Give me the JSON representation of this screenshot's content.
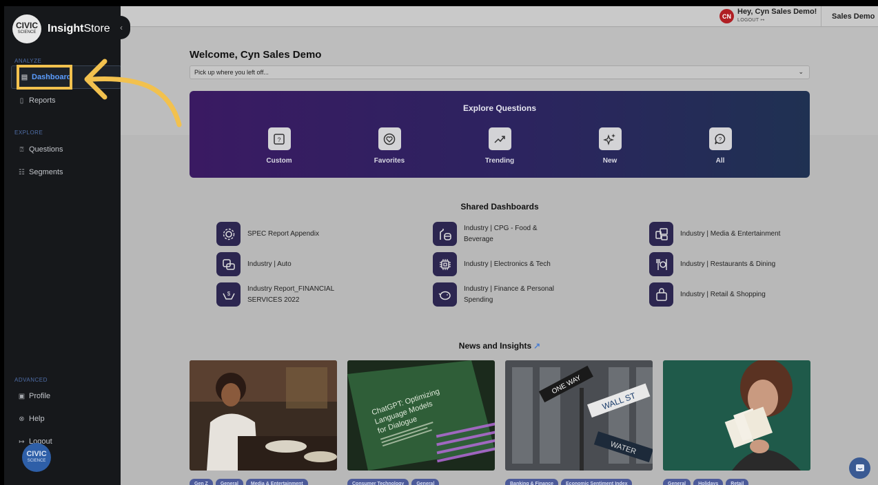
{
  "sidebar": {
    "logo": {
      "badge_top": "CIVIC",
      "badge_bottom": "SCIENCE",
      "brand_bold": "Insight",
      "brand_rest": "Store"
    },
    "collapse_icon": "chevron-left-icon",
    "sections": [
      {
        "label": "ANALYZE",
        "items": [
          {
            "label": "Dashboard",
            "icon": "dashboard-icon",
            "active": true
          },
          {
            "label": "Reports",
            "icon": "document-icon"
          }
        ]
      },
      {
        "label": "EXPLORE",
        "items": [
          {
            "label": "Questions",
            "icon": "question-icon"
          },
          {
            "label": "Segments",
            "icon": "segments-icon"
          }
        ]
      },
      {
        "label": "ADVANCED",
        "items": [
          {
            "label": "Profile",
            "icon": "profile-icon"
          },
          {
            "label": "Help",
            "icon": "help-icon"
          },
          {
            "label": "Logout",
            "icon": "logout-icon"
          }
        ]
      }
    ],
    "bottom_badge": {
      "top": "CIVIC",
      "bottom": "SCIENCE"
    }
  },
  "topbar": {
    "avatar_initials": "CN",
    "greeting": "Hey, Cyn Sales Demo!",
    "logout": "LOGOUT",
    "org": "Sales Demo"
  },
  "main": {
    "welcome": "Welcome, Cyn Sales Demo",
    "select_placeholder": "Pick up where you left off...",
    "explore": {
      "title": "Explore Questions",
      "items": [
        {
          "label": "Custom",
          "icon": "custom-question-icon"
        },
        {
          "label": "Favorites",
          "icon": "heart-icon"
        },
        {
          "label": "Trending",
          "icon": "trending-icon"
        },
        {
          "label": "New",
          "icon": "sparkle-icon"
        },
        {
          "label": "All",
          "icon": "chat-bubble-icon"
        }
      ]
    },
    "shared": {
      "title": "Shared Dashboards",
      "items": [
        {
          "label": "SPEC Report Appendix",
          "icon": "gear-icon"
        },
        {
          "label": "Industry | CPG - Food & Beverage",
          "icon": "food-icon"
        },
        {
          "label": "Industry | Media & Entertainment",
          "icon": "media-icon"
        },
        {
          "label": "Industry | Auto",
          "icon": "car-icon"
        },
        {
          "label": "Industry | Electronics & Tech",
          "icon": "chip-icon"
        },
        {
          "label": "Industry | Restaurants & Dining",
          "icon": "dining-icon"
        },
        {
          "label": "Industry Report_FINANCIAL SERVICES 2022",
          "icon": "money-hands-icon"
        },
        {
          "label": "Industry | Finance & Personal Spending",
          "icon": "piggy-bank-icon"
        },
        {
          "label": "Industry | Retail & Shopping",
          "icon": "shopping-bag-icon"
        }
      ]
    },
    "news": {
      "title": "News and Insights",
      "cards": [
        {
          "image": "woman-eating-photo",
          "tags": [
            "Gen Z",
            "General",
            "Media & Entertainment"
          ]
        },
        {
          "image": "chatgpt-screen-photo",
          "image_text": "ChatGPT: Optimizing Language Models for Dialogue",
          "tags": [
            "Consumer Technology",
            "General"
          ]
        },
        {
          "image": "wall-street-sign-photo",
          "image_text": [
            "ONE WAY",
            "WALL ST",
            "WATER"
          ],
          "tags": [
            "Banking & Finance",
            "Economic Sentiment Index"
          ]
        },
        {
          "image": "woman-holding-cards-photo",
          "tags": [
            "General",
            "Holidays",
            "Retail"
          ]
        }
      ]
    }
  },
  "colors": {
    "accent": "#f2c14e",
    "active_nav": "#5b9dff",
    "sidebar_bg": "#16181b",
    "explore_start": "#3a1a62",
    "explore_end": "#1f3152",
    "tag_bg": "#4c5a99"
  }
}
